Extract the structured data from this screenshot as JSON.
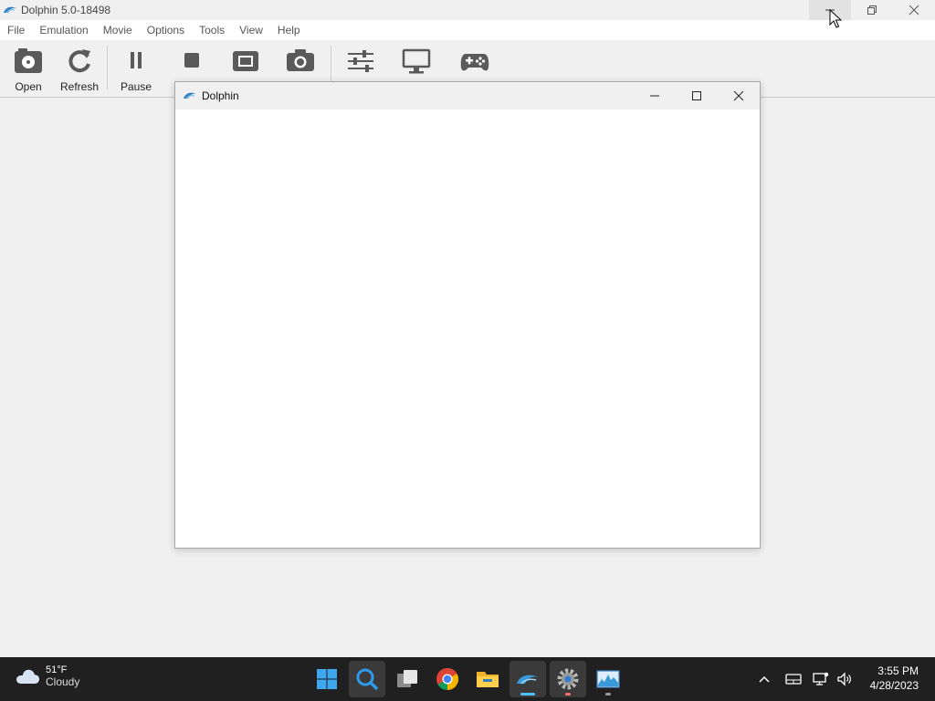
{
  "window": {
    "title": "Dolphin 5.0-18498",
    "minimize_icon": "minimize-icon",
    "restore_icon": "restore-icon",
    "close_icon": "close-icon"
  },
  "menu": [
    "File",
    "Emulation",
    "Movie",
    "Options",
    "Tools",
    "View",
    "Help"
  ],
  "toolbar": {
    "open_label": "Open",
    "refresh_label": "Refresh",
    "pause_label": "Pause"
  },
  "render_window": {
    "title": "Dolphin"
  },
  "taskbar": {
    "weather_temp": "51°F",
    "weather_condition": "Cloudy",
    "time": "3:55 PM",
    "date": "4/28/2023"
  },
  "colors": {
    "accent": "#4cc2ff",
    "taskbar": "#202020",
    "chrome": "#f0f0f0"
  }
}
